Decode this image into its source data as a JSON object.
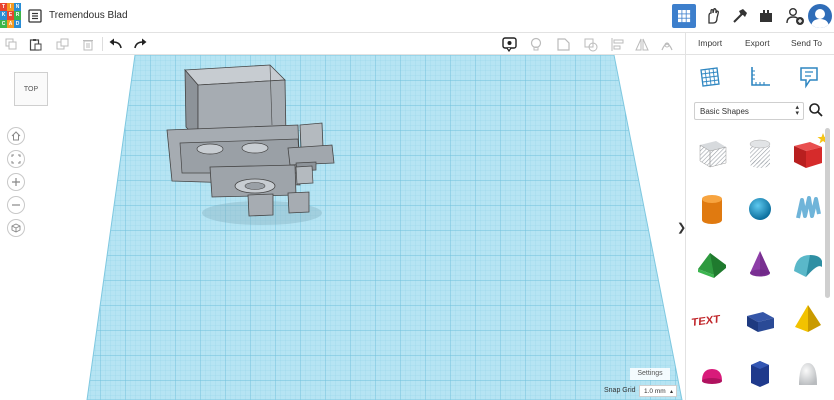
{
  "app": {
    "design_title": "Tremendous Blad",
    "logo_letters": [
      "T",
      "I",
      "N",
      "K",
      "E",
      "R",
      "C",
      "A",
      "D"
    ]
  },
  "toolbar": {
    "icons": [
      "copy-icon",
      "paste-icon",
      "duplicate-icon",
      "delete-icon",
      "undo-icon",
      "redo-icon",
      "note-icon",
      "light-bulb-icon",
      "group-icon",
      "ungroup-icon",
      "align-icon",
      "mirror-icon"
    ]
  },
  "actions": {
    "import": "Import",
    "export": "Export",
    "send_to": "Send To"
  },
  "panel": {
    "category": "Basic Shapes",
    "shapes": [
      "box-hole",
      "cylinder-hole",
      "box",
      "cylinder",
      "sphere",
      "scribble",
      "roof",
      "cone",
      "round-roof",
      "text",
      "wedge",
      "pyramid",
      "half-sphere",
      "polygon",
      "paraboloid"
    ]
  },
  "viewport": {
    "viewcube_label": "TOP",
    "settings_label": "Settings",
    "snap_grid_label": "Snap Grid",
    "snap_grid_value": "1.0 mm"
  },
  "colors": {
    "accent": "#3d7fcc",
    "grid_bg": "#a9dff0",
    "grid_line": "#7fc8e0"
  }
}
